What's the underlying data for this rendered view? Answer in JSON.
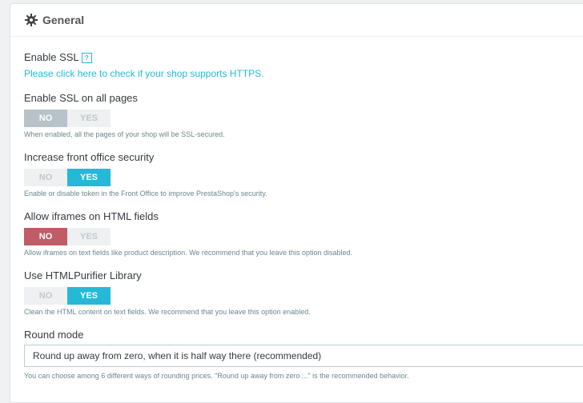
{
  "panel": {
    "title": "General"
  },
  "ssl": {
    "label": "Enable SSL",
    "help_badge": "?",
    "check_link": "Please click here to check if your shop supports HTTPS."
  },
  "ssl_all": {
    "label": "Enable SSL on all pages",
    "no": "NO",
    "yes": "YES",
    "selected": "NO",
    "hint": "When enabled, all the pages of your shop will be SSL-secured."
  },
  "front_security": {
    "label": "Increase front office security",
    "no": "NO",
    "yes": "YES",
    "selected": "YES",
    "hint": "Enable or disable token in the Front Office to improve PrestaShop's security."
  },
  "iframes": {
    "label": "Allow iframes on HTML fields",
    "no": "NO",
    "yes": "YES",
    "selected": "NO",
    "hint": "Allow iframes on text fields like product description. We recommend that you leave this option disabled."
  },
  "purifier": {
    "label": "Use HTMLPurifier Library",
    "no": "NO",
    "yes": "YES",
    "selected": "YES",
    "hint": "Clean the HTML content on text fields. We recommend that you leave this option enabled."
  },
  "round_mode": {
    "label": "Round mode",
    "value": "Round up away from zero, when it is half way there (recommended)",
    "hint": "You can choose among 6 different ways of rounding prices. \"Round up away from zero ...\" is the recommended behavior."
  },
  "colors": {
    "accent": "#25b9d7",
    "switch_no_gray": "#b7c3c9",
    "switch_no_red": "#c05c67"
  }
}
